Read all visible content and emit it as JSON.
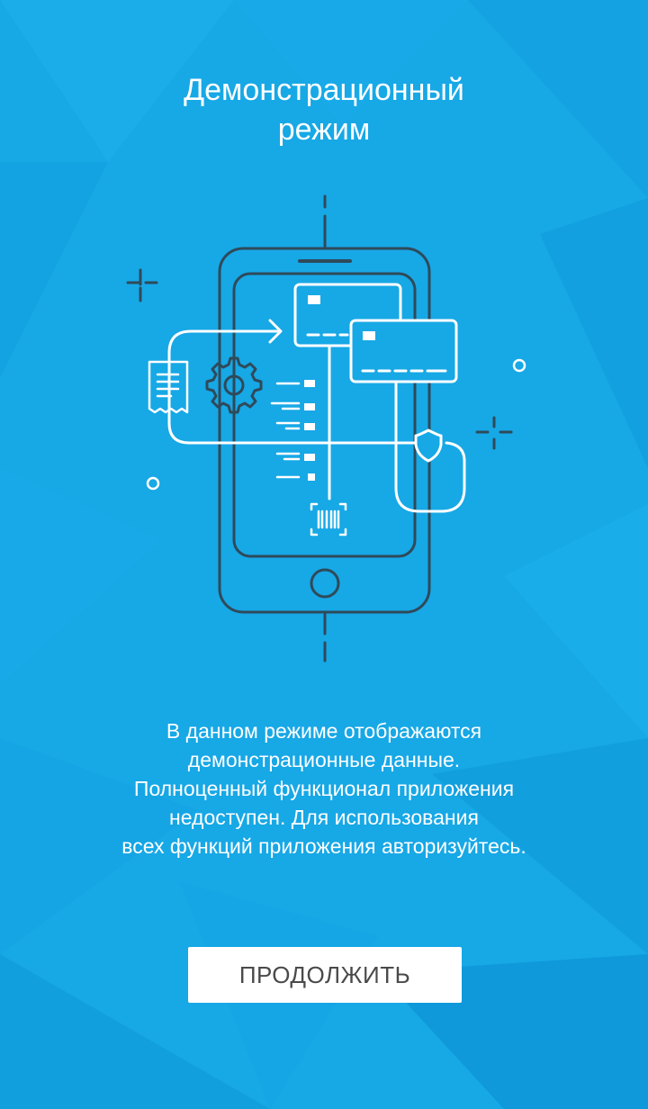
{
  "screen": {
    "title_line1": "Демонстрационный",
    "title_line2": "режим",
    "description_lines": [
      "В данном режиме отображаются",
      "демонстрационные данные.",
      "Полноценный функционал приложения",
      "недоступен. Для использования",
      "всех функций приложения авторизуйтесь."
    ],
    "continue_button_label": "ПРОДОЛЖИТЬ"
  },
  "illustration": {
    "name": "demo-mode-phone-illustration",
    "icons": [
      "phone-icon",
      "card-icon",
      "card-icon",
      "receipt-icon",
      "gear-icon",
      "shield-icon",
      "barcode-scan-icon",
      "home-button-icon"
    ]
  },
  "colors": {
    "background": "#17a8e6",
    "background_dark": "#0f8fd4",
    "line_white": "#ffffff",
    "line_dark": "#2f4a5a",
    "button_bg": "#ffffff",
    "button_text": "#4a4a4a"
  }
}
